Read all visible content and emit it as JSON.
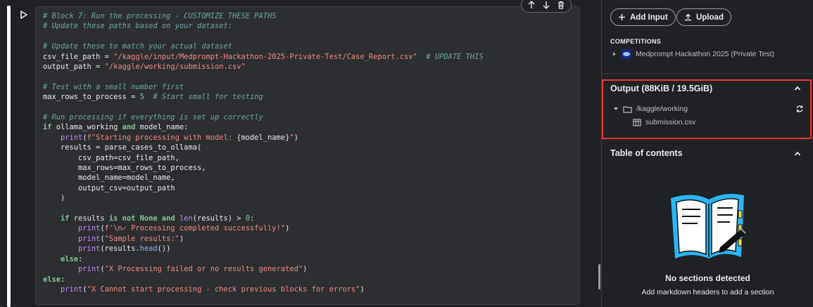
{
  "cell": {
    "code_lines": [
      [
        {
          "t": "# Block 7: Run the processing - CUSTOMIZE THESE PATHS",
          "c": "com"
        }
      ],
      [
        {
          "t": "# Update these paths based on your dataset:",
          "c": "com"
        }
      ],
      [],
      [
        {
          "t": "# Update these to match your actual dataset",
          "c": "com"
        }
      ],
      [
        {
          "t": "csv_file_path = "
        },
        {
          "t": "\"/kaggle/input/Medprompt-Hackathon-2025-Private-Test/Case_Report.csv\"",
          "c": "str"
        },
        {
          "t": "  "
        },
        {
          "t": "# UPDATE THIS",
          "c": "com"
        }
      ],
      [
        {
          "t": "output_path = "
        },
        {
          "t": "\"/kaggle/working/submission.csv\"",
          "c": "str"
        }
      ],
      [],
      [
        {
          "t": "# Test with a small number first",
          "c": "com"
        }
      ],
      [
        {
          "t": "max_rows_to_process = "
        },
        {
          "t": "5",
          "c": "num"
        },
        {
          "t": "  "
        },
        {
          "t": "# Start small for testing",
          "c": "com"
        }
      ],
      [],
      [
        {
          "t": "# Run processing if everything is set up correctly",
          "c": "com"
        }
      ],
      [
        {
          "t": "if",
          "c": "kw"
        },
        {
          "t": " ollama_working "
        },
        {
          "t": "and",
          "c": "kw"
        },
        {
          "t": " model_name:"
        }
      ],
      [
        {
          "t": "    "
        },
        {
          "t": "print",
          "c": "fn"
        },
        {
          "t": "("
        },
        {
          "t": "f\"Starting processing with model: ",
          "c": "str"
        },
        {
          "t": "{model_name}"
        },
        {
          "t": "\"",
          "c": "str"
        },
        {
          "t": ")"
        }
      ],
      [
        {
          "t": "    results = parse_cases_to_ollama("
        }
      ],
      [
        {
          "t": "        csv_path=csv_file_path,"
        }
      ],
      [
        {
          "t": "        max_rows=max_rows_to_process,"
        }
      ],
      [
        {
          "t": "        model_name=model_name,"
        }
      ],
      [
        {
          "t": "        output_csv=output_path"
        }
      ],
      [
        {
          "t": "    )"
        }
      ],
      [],
      [
        {
          "t": "    "
        },
        {
          "t": "if",
          "c": "kw"
        },
        {
          "t": " results "
        },
        {
          "t": "is not None and",
          "c": "kw"
        },
        {
          "t": " "
        },
        {
          "t": "len",
          "c": "fn"
        },
        {
          "t": "(results) > "
        },
        {
          "t": "0",
          "c": "num"
        },
        {
          "t": ":"
        }
      ],
      [
        {
          "t": "        "
        },
        {
          "t": "print",
          "c": "fn"
        },
        {
          "t": "("
        },
        {
          "t": "f'\\n✓ Processing completed successfully!\"",
          "c": "str"
        },
        {
          "t": ")"
        }
      ],
      [
        {
          "t": "        "
        },
        {
          "t": "print",
          "c": "fn"
        },
        {
          "t": "("
        },
        {
          "t": "\"Sample results:\"",
          "c": "str"
        },
        {
          "t": ")"
        }
      ],
      [
        {
          "t": "        "
        },
        {
          "t": "print",
          "c": "fn"
        },
        {
          "t": "(results."
        },
        {
          "t": "head",
          "c": "attr"
        },
        {
          "t": "())"
        }
      ],
      [
        {
          "t": "    "
        },
        {
          "t": "else",
          "c": "kw"
        },
        {
          "t": ":"
        }
      ],
      [
        {
          "t": "        "
        },
        {
          "t": "print",
          "c": "fn"
        },
        {
          "t": "("
        },
        {
          "t": "\"X Processing failed or no results generated\"",
          "c": "str"
        },
        {
          "t": ")"
        }
      ],
      [
        {
          "t": "else",
          "c": "kw"
        },
        {
          "t": ":"
        }
      ],
      [
        {
          "t": "    "
        },
        {
          "t": "print",
          "c": "fn"
        },
        {
          "t": "("
        },
        {
          "t": "\"X Cannot start processing - check previous blocks for errors\"",
          "c": "str"
        },
        {
          "t": ")"
        }
      ]
    ]
  },
  "sidebar": {
    "add_input_label": "Add Input",
    "upload_label": "Upload",
    "competitions_label": "COMPETITIONS",
    "competition_name": "Medprompt Hackathon 2025 (Private Test)",
    "output": {
      "title": "Output (88KiB / 19.5GiB)",
      "folder": "/kaggle/working",
      "file": "submission.csv"
    },
    "toc": {
      "title": "Table of contents",
      "empty_title": "No sections detected",
      "empty_subtitle": "Add markdown headers to add a section"
    }
  },
  "colors": {
    "highlight_border": "#e53935",
    "illustration_blue": "#29b6f6",
    "illustration_yellow": "#fdd835"
  }
}
